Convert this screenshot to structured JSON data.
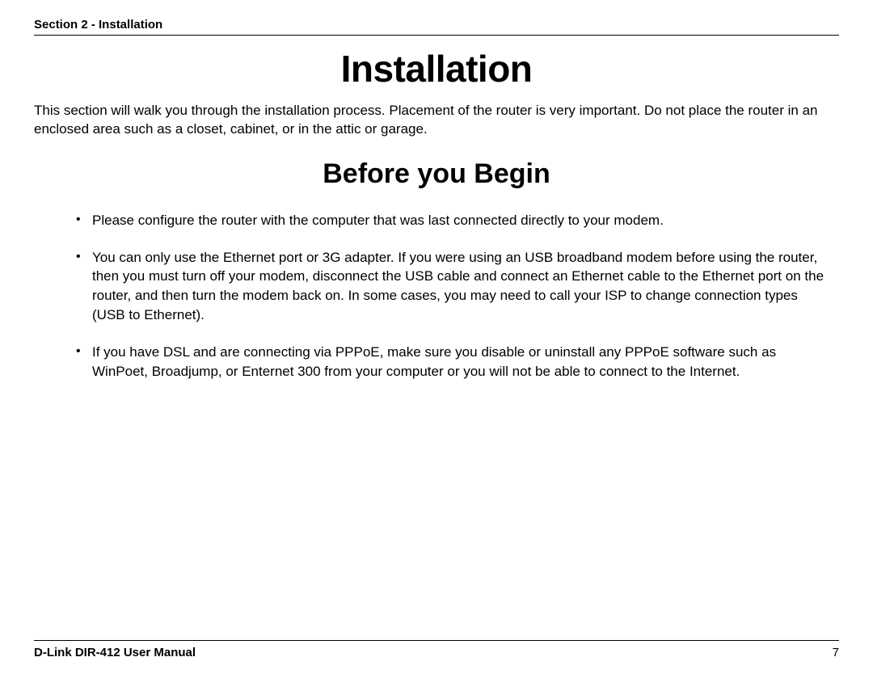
{
  "header": {
    "section_line": "Section 2 - Installation"
  },
  "title": "Installation",
  "intro": "This section will walk you through the installation process. Placement of the router is very important. Do not place the router in an enclosed area such as a closet, cabinet, or in the attic or garage.",
  "subtitle": "Before you Begin",
  "bullets": [
    "Please configure the router with the computer that was last connected directly to your modem.",
    "You can only use the Ethernet port or 3G adapter. If you were using an USB broadband modem before using the router, then you must turn off your modem, disconnect the USB cable and connect an Ethernet cable to the Ethernet port on the router, and then turn the modem back on. In some cases, you may need to call your ISP to change connection types (USB to Ethernet).",
    "If you have DSL and are connecting via PPPoE, make sure you disable or uninstall any PPPoE software such as WinPoet, Broadjump, or Enternet 300 from your computer or you will not be able to connect to the Internet."
  ],
  "footer": {
    "left": "D-Link DIR-412 User Manual",
    "right": "7"
  }
}
